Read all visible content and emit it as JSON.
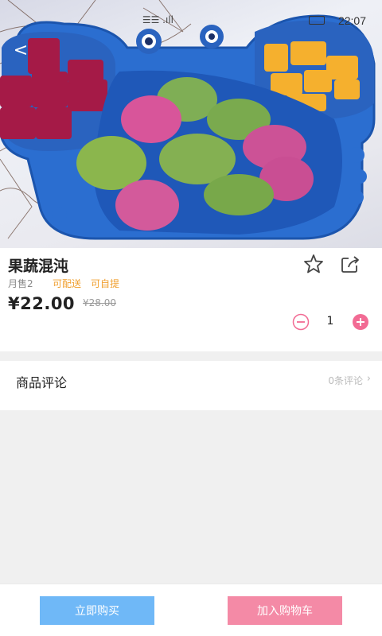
{
  "status_bar": {
    "time": "22:07",
    "signal": "☰☰ .ıll"
  },
  "nav": {
    "back_label": "<"
  },
  "product": {
    "title": "果蔬混沌",
    "monthly_sales": "月售2",
    "tags": [
      "可配送",
      "可自提"
    ],
    "price": "¥22.00",
    "original_price": "¥28.00",
    "quantity": "1"
  },
  "reviews": {
    "title": "商品评论",
    "count_label": "0条评论"
  },
  "actions": {
    "buy_now": "立即购买",
    "add_to_cart": "加入购物车"
  },
  "icons": {
    "back": "back-chevron-icon",
    "favorite": "star-outline-icon",
    "share": "share-icon",
    "minus": "minus-circle-icon",
    "plus": "plus-circle-icon"
  },
  "colors": {
    "buy_button": "#6fb8f7",
    "cart_button": "#f48aa6",
    "tag": "#f0a030",
    "stepper": "#f26b94"
  }
}
